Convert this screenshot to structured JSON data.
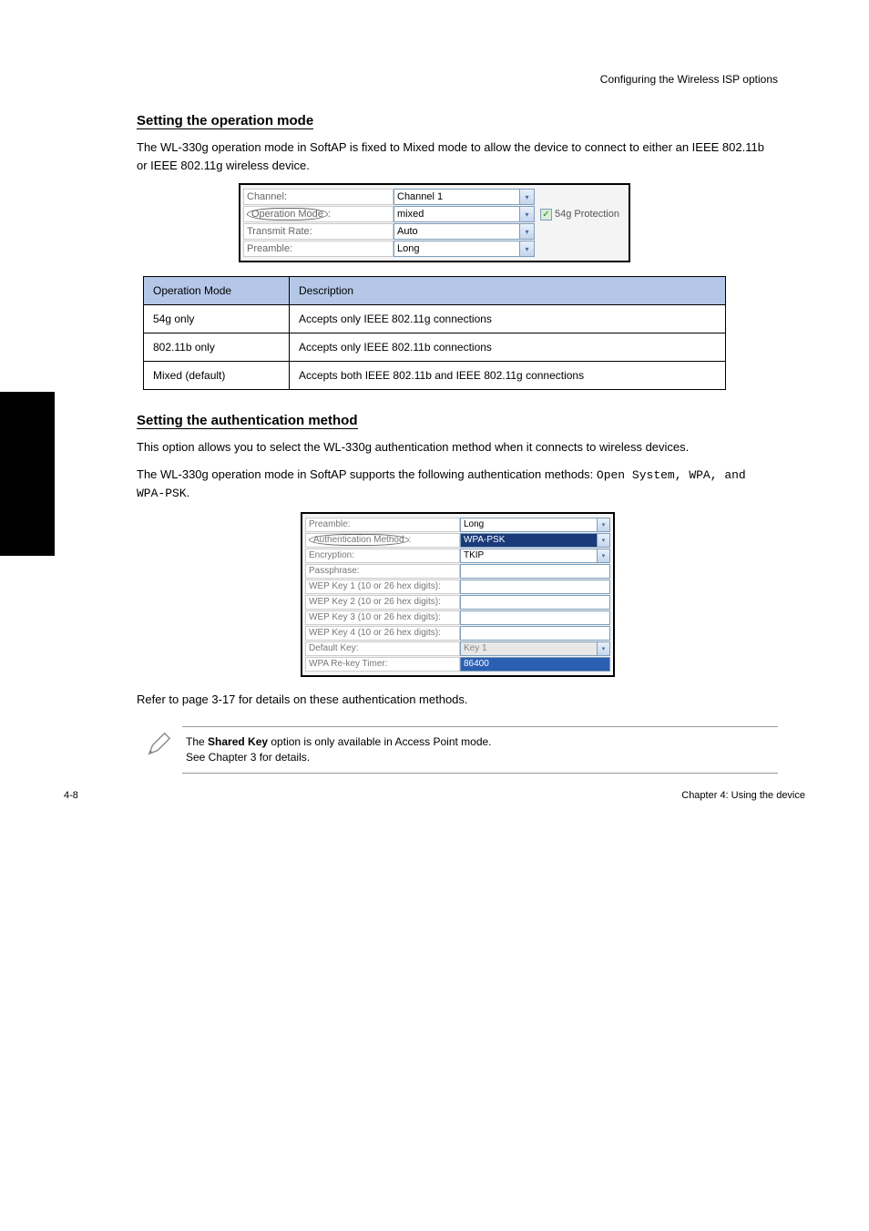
{
  "page_header": "Configuring the Wireless ISP options",
  "section1": {
    "heading": "Setting the operation mode",
    "paragraph": "The WL-330g operation mode in SoftAP is fixed to Mixed mode to allow the device to connect to either an IEEE 802.11b or IEEE 802.11g wireless device."
  },
  "screenshot1": {
    "rows": [
      {
        "label": "Channel:",
        "value": "Channel 1",
        "circled": false,
        "checkbox": null
      },
      {
        "label": "Operation Mode:",
        "value": "mixed",
        "circled": true,
        "checkbox": "54g Protection"
      },
      {
        "label": "Transmit Rate:",
        "value": "Auto",
        "circled": false,
        "checkbox": null
      },
      {
        "label": "Preamble:",
        "value": "Long",
        "circled": false,
        "checkbox": null
      }
    ]
  },
  "table": {
    "headers": [
      "Operation Mode",
      "Description"
    ],
    "rows": [
      [
        "54g only",
        "Accepts only IEEE 802.11g connections"
      ],
      [
        "802.11b only",
        "Accepts only IEEE 802.11b connections"
      ],
      [
        "Mixed (default)",
        "Accepts both IEEE 802.11b and IEEE 802.11g connections"
      ]
    ]
  },
  "section2": {
    "heading": "Setting the authentication method",
    "para1": "This option allows you to select the WL-330g authentication method when it connects to wireless devices.",
    "para_methods_intro": "The WL-330g operation mode in SoftAP supports the following authentication methods: ",
    "methods": "Open System, WPA, and WPA-PSK"
  },
  "screenshot2": {
    "rows": [
      {
        "label": "Preamble:",
        "value": "Long",
        "kind": "select",
        "circled": false,
        "highlighted": false
      },
      {
        "label": "Authentication Method:",
        "value": "WPA-PSK",
        "kind": "select",
        "circled": true,
        "highlighted": true
      },
      {
        "label": "Encryption:",
        "value": "TKIP",
        "kind": "select",
        "circled": false,
        "highlighted": false
      },
      {
        "label": "Passphrase:",
        "value": "",
        "kind": "input",
        "circled": false
      },
      {
        "label": "WEP Key 1 (10 or 26 hex digits):",
        "value": "",
        "kind": "input",
        "circled": false
      },
      {
        "label": "WEP Key 2 (10 or 26 hex digits):",
        "value": "",
        "kind": "input",
        "circled": false
      },
      {
        "label": "WEP Key 3 (10 or 26 hex digits):",
        "value": "",
        "kind": "input",
        "circled": false
      },
      {
        "label": "WEP Key 4 (10 or 26 hex digits):",
        "value": "",
        "kind": "input",
        "circled": false
      },
      {
        "label": "Default Key:",
        "value": "Key 1",
        "kind": "select-disabled",
        "circled": false
      },
      {
        "label": "WPA Re-key Timer:",
        "value": "86400",
        "kind": "input-sel",
        "circled": false
      }
    ]
  },
  "refer_text": "Refer to page 3-17 for details on these authentication methods.",
  "note": {
    "line1_prefix": "The ",
    "line1_bold": "Shared Key",
    "line1_suffix": " option is only available in Access Point mode.",
    "line2": "See Chapter 3 for details."
  },
  "footer": {
    "left": "4-8",
    "right": "Chapter 4: Using the device"
  }
}
